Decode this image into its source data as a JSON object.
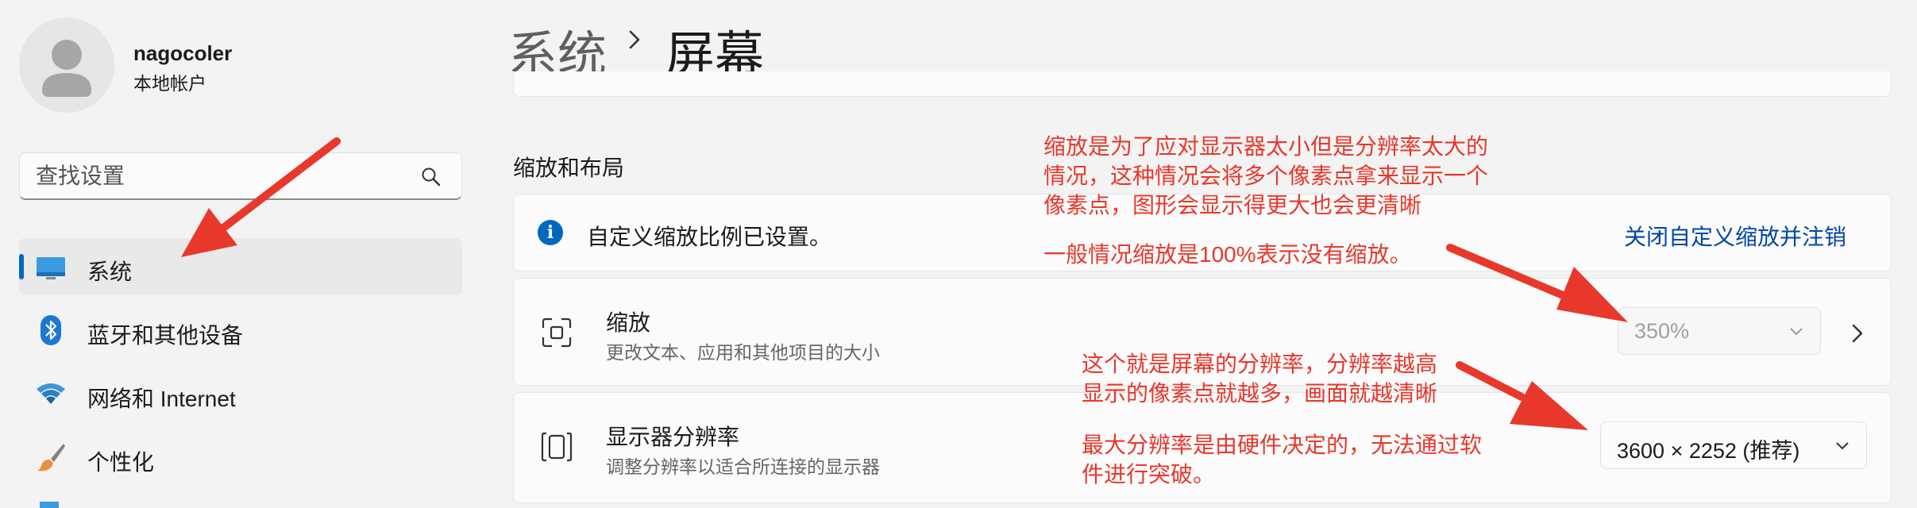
{
  "sidebar": {
    "user_name": "nagocoler",
    "user_type": "本地帐户",
    "search_placeholder": "查找设置",
    "items": [
      {
        "label": "系统",
        "icon": "monitor-icon"
      },
      {
        "label": "蓝牙和其他设备",
        "icon": "bluetooth-icon"
      },
      {
        "label": "网络和 Internet",
        "icon": "wifi-icon"
      },
      {
        "label": "个性化",
        "icon": "brush-icon"
      }
    ]
  },
  "header": {
    "parent": "系统",
    "current": "屏幕"
  },
  "main": {
    "section_title": "缩放和布局",
    "info": {
      "text": "自定义缩放比例已设置。",
      "link": "关闭自定义缩放并注销"
    },
    "scale": {
      "title": "缩放",
      "description": "更改文本、应用和其他项目的大小",
      "value": "350%"
    },
    "resolution": {
      "title": "显示器分辨率",
      "description": "调整分辨率以适合所连接的显示器",
      "value": "3600 × 2252 (推荐)"
    }
  },
  "annotations": {
    "scaling_lines": [
      "缩放是为了应对显示器太小但是分辨率太大的",
      "情况，这种情况会将多个像素点拿来显示一个",
      "像素点，图形会显示得更大也会更清晰"
    ],
    "scaling_note": "一般情况缩放是100%表示没有缩放。",
    "resolution_lines": [
      "这个就是屏幕的分辨率，分辨率越高",
      "显示的像素点就越多，画面就越清晰"
    ],
    "hardware_lines": [
      "最大分辨率是由硬件决定的，无法通过软",
      "件进行突破。"
    ]
  },
  "colors": {
    "accent": "#0067c0",
    "link": "#0047a6",
    "annotation": "#e8382c"
  }
}
